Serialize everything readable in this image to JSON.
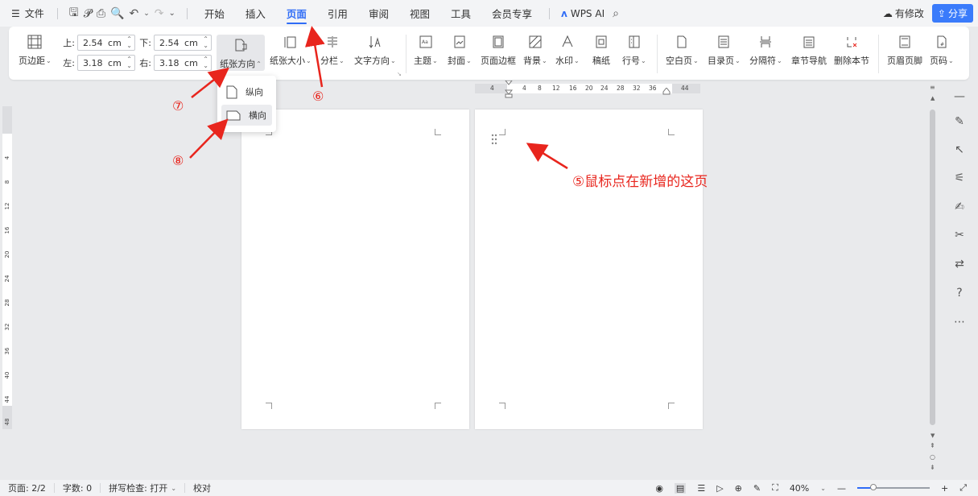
{
  "topbar": {
    "file_label": "文件",
    "tabs": [
      {
        "label": "开始"
      },
      {
        "label": "插入"
      },
      {
        "label": "页面",
        "active": true
      },
      {
        "label": "引用"
      },
      {
        "label": "审阅"
      },
      {
        "label": "视图"
      },
      {
        "label": "工具"
      },
      {
        "label": "会员专享"
      }
    ],
    "wps_ai": "WPS AI",
    "modify_label": "有修改",
    "share_label": "分享",
    "accent_color": "#2f6cf6"
  },
  "ribbon": {
    "margins_label": "页边距",
    "top_label": "上:",
    "top_value": "2.54",
    "bottom_label": "下:",
    "bottom_value": "2.54",
    "left_label": "左:",
    "left_value": "3.18",
    "right_label": "右:",
    "right_value": "3.18",
    "unit": "cm",
    "orientation_label": "纸张方向",
    "size_label": "纸张大小",
    "columns_label": "分栏",
    "text_direction_label": "文字方向",
    "theme_label": "主题",
    "cover_label": "封面",
    "border_label": "页面边框",
    "background_label": "背景",
    "watermark_label": "水印",
    "draft_label": "稿纸",
    "line_number_label": "行号",
    "blank_page_label": "空白页",
    "toc_label": "目录页",
    "separator_label": "分隔符",
    "chapter_nav_label": "章节导航",
    "delete_section_label": "删除本节",
    "header_footer_label": "页眉页脚",
    "page_number_label": "页码"
  },
  "dropdown": {
    "portrait": "纵向",
    "landscape": "横向"
  },
  "vruler_numbers": [
    "4",
    "8",
    "12",
    "16",
    "20",
    "24",
    "28",
    "32",
    "36",
    "40",
    "44",
    "48"
  ],
  "hruler_numbers": [
    "4",
    "4",
    "8",
    "12",
    "16",
    "20",
    "24",
    "28",
    "32",
    "36",
    "44"
  ],
  "annotations": {
    "a5": "⑤鼠标点在新增的这页",
    "a6": "⑥",
    "a7": "⑦",
    "a8": "⑧",
    "color": "#e8251d"
  },
  "status": {
    "page": "页面: 2/2",
    "words": "字数: 0",
    "spell": "拼写检查: 打开",
    "proof": "校对",
    "zoom": "40%"
  }
}
